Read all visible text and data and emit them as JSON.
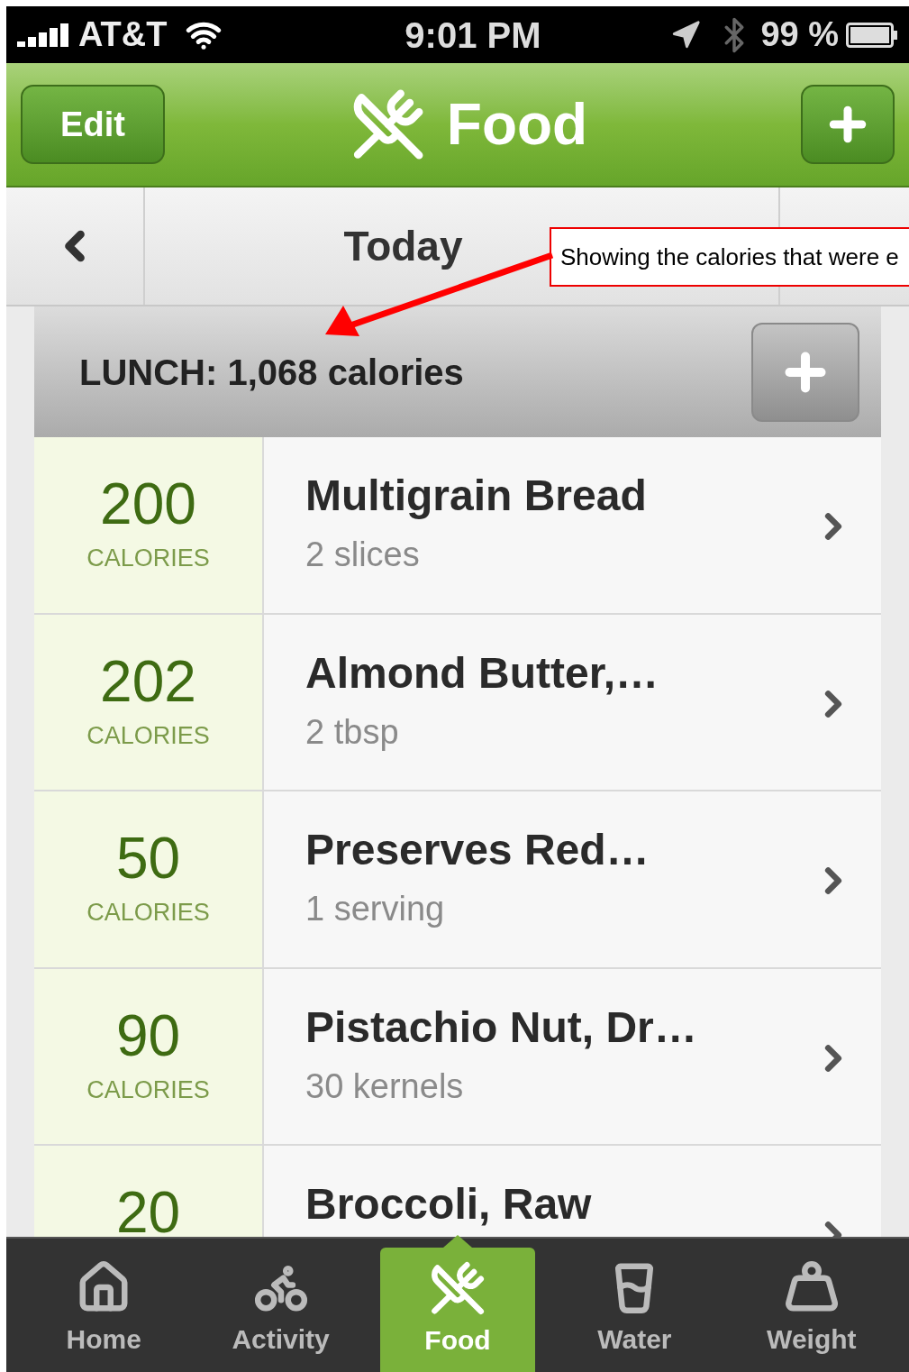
{
  "status_bar": {
    "carrier": "AT&T",
    "time": "9:01 PM",
    "battery": "99 %"
  },
  "nav_bar": {
    "left_button": "Edit",
    "title": "Food"
  },
  "date_bar": {
    "label": "Today"
  },
  "annotation": {
    "text": "Showing the calories that were e"
  },
  "meal": {
    "header": "LUNCH: 1,068 calories",
    "items": [
      {
        "calories": "200",
        "unit": "CALORIES",
        "name": "Multigrain Bread",
        "amount": "2 slices"
      },
      {
        "calories": "202",
        "unit": "CALORIES",
        "name": "Almond Butter,…",
        "amount": "2 tbsp"
      },
      {
        "calories": "50",
        "unit": "CALORIES",
        "name": "Preserves Red…",
        "amount": "1 serving"
      },
      {
        "calories": "90",
        "unit": "CALORIES",
        "name": "Pistachio Nut, Dr…",
        "amount": "30 kernels"
      },
      {
        "calories": "20",
        "name": "Broccoli, Raw"
      }
    ]
  },
  "tab_bar": [
    {
      "label": "Home",
      "selected": false
    },
    {
      "label": "Activity",
      "selected": false
    },
    {
      "label": "Food",
      "selected": true
    },
    {
      "label": "Water",
      "selected": false
    },
    {
      "label": "Weight",
      "selected": false
    }
  ]
}
